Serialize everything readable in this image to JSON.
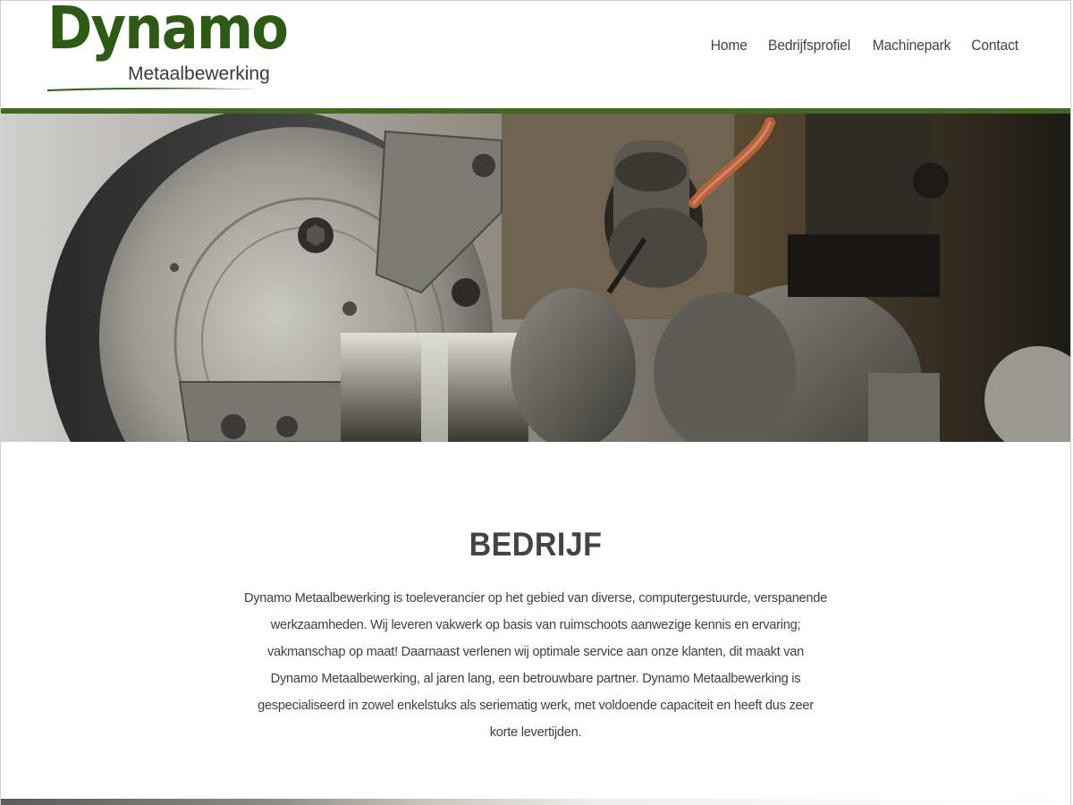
{
  "brand": {
    "name": "Dynamo",
    "tagline": "Metaalbewerking",
    "color": "#2f5a16"
  },
  "nav": {
    "items": [
      {
        "label": "Home"
      },
      {
        "label": "Bedrijfsprofiel"
      },
      {
        "label": "Machinepark"
      },
      {
        "label": "Contact"
      }
    ]
  },
  "hero": {
    "image": "lathe-chuck-machining-photo"
  },
  "section": {
    "title": "BEDRIJF",
    "body": "Dynamo Metaalbewerking is toeleverancier op het gebied van diverse, computergestuurde, verspanende werkzaamheden. Wij leveren vakwerk op basis van ruimschoots aanwezige kennis en ervaring; vakmanschap op maat! Daarnaast verlenen wij optimale service aan onze klanten, dit maakt van Dynamo Metaalbewerking, al jaren lang, een betrouwbare partner. Dynamo Metaalbewerking is gespecialiseerd in zowel enkelstuks als seriematig werk, met voldoende capaciteit en heeft dus zeer korte levertijden."
  },
  "colors": {
    "accent_bar": "#3d6a1f",
    "text": "#444444"
  }
}
